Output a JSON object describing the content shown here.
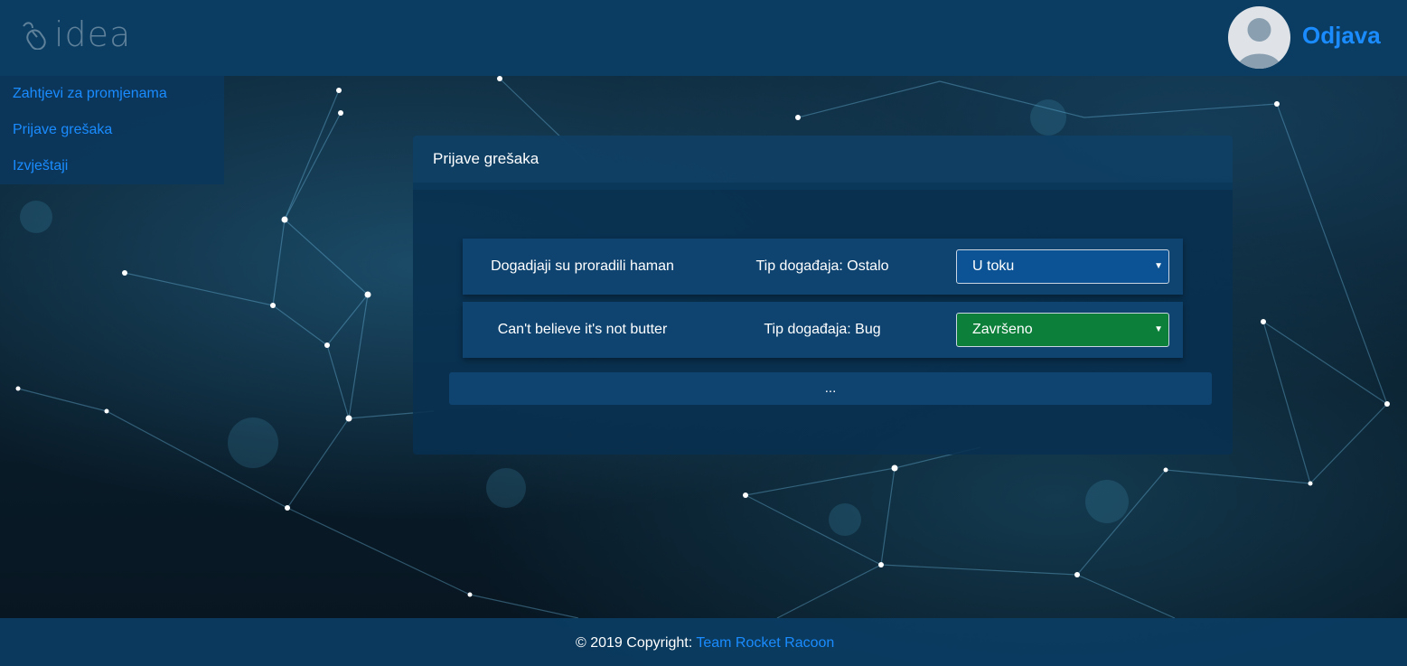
{
  "header": {
    "logo_text": "idea",
    "logout_label": "Odjava"
  },
  "sidebar": {
    "items": [
      {
        "label": "Zahtjevi za promjenama"
      },
      {
        "label": "Prijave grešaka"
      },
      {
        "label": "Izvještaji"
      }
    ]
  },
  "panel": {
    "title": "Prijave grešaka",
    "reports": [
      {
        "title": "Dogadjaji su proradili haman",
        "type": "Tip događaja: Ostalo",
        "status": "U toku",
        "status_color": "#0b5394"
      },
      {
        "title": "Can't believe it's not butter",
        "type": "Tip događaja: Bug",
        "status": "Završeno",
        "status_color": "#0c7f3a"
      }
    ],
    "more_label": "..."
  },
  "footer": {
    "copyright": "© 2019 Copyright:",
    "team_link": "Team Rocket Racoon"
  },
  "colors": {
    "header_bg": "#0b3d63",
    "link": "#1a8cff"
  }
}
